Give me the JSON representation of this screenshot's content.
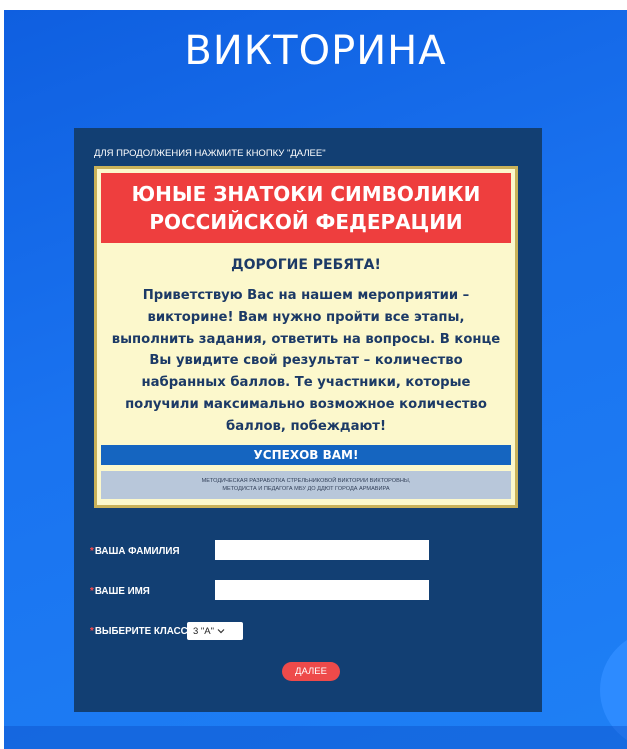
{
  "page": {
    "title": "ВИКТОРИНА"
  },
  "form": {
    "hint": "ДЛЯ ПРОДОЛЖЕНИЯ НАЖМИТЕ КНОПКУ \"ДАЛЕЕ\"",
    "surname_label": "ВАША ФАМИЛИЯ",
    "surname_value": "",
    "name_label": "ВАШЕ ИМЯ",
    "name_value": "",
    "class_label": "ВЫБЕРИТЕ КЛАСС",
    "class_selected": "3 \"А\"",
    "required_marker": "*",
    "next_label": "ДАЛЕЕ"
  },
  "card": {
    "header_line1": "ЮНЫЕ ЗНАТОКИ СИМВОЛИКИ",
    "header_line2": "РОССИЙСКОЙ ФЕДЕРАЦИИ",
    "greeting": "ДОРОГИЕ РЕБЯТА!",
    "body": "Приветствую Вас на нашем мероприятии – викторине! Вам нужно пройти все этапы, выполнить задания, ответить на вопросы. В конце Вы увидите свой результат – количество набранных баллов. Те участники, которые получили максимально возможное количество баллов, побеждают!",
    "success": "УСПЕХОВ ВАМ!",
    "credit_line1": "МЕТОДИЧЕСКАЯ РАЗРАБОТКА СТРЕЛЬНИКОВОЙ ВИКТОРИИ ВИКТОРОВНЫ,",
    "credit_line2": "МЕТОДИСТА И ПЕДАГОГА МБУ ДО ДДЮТ ГОРОДА АРМАВИРА"
  },
  "icons": {
    "select_chevron": "chevron-down-icon"
  },
  "colors": {
    "background": "#1a73f0",
    "panel": "#123f73",
    "card_header": "#ee3e3e",
    "card_bg": "#fcf8cc",
    "success_bar": "#1565c0",
    "button": "#ee4a4a"
  }
}
